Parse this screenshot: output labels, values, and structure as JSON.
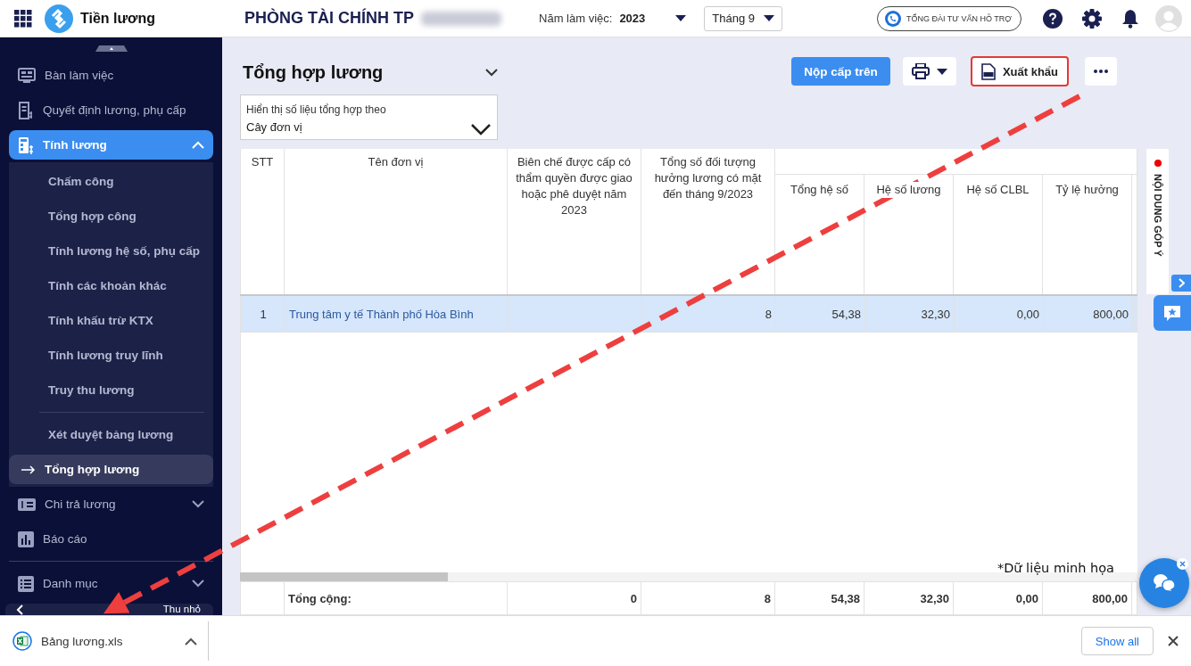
{
  "header": {
    "app_name": "Tiền lương",
    "org_title": "PHÒNG TÀI CHÍNH TP",
    "year_label": "Năm làm việc:",
    "year": "2023",
    "month": "Tháng 9",
    "hotline": "TỔNG ĐÀI TƯ VẤN HỖ TRỢ"
  },
  "sidebar": {
    "items": [
      {
        "label": "Bàn làm việc",
        "selected": false
      },
      {
        "label": "Quyết định lương, phụ cấp",
        "selected": false
      },
      {
        "label": "Tính lương",
        "selected": true,
        "expanded": true,
        "children": [
          {
            "label": "Chấm công",
            "selected": false
          },
          {
            "label": "Tổng hợp công",
            "selected": false
          },
          {
            "label": "Tính lương hệ số, phụ cấp",
            "selected": false
          },
          {
            "label": "Tính các khoản khác",
            "selected": false
          },
          {
            "label": "Tính khấu trừ KTX",
            "selected": false
          },
          {
            "label": "Tính lương truy lĩnh",
            "selected": false
          },
          {
            "label": "Truy thu lương",
            "selected": false
          },
          {
            "label": "Xét duyệt bảng lương",
            "selected": false,
            "group_break": true
          },
          {
            "label": "Tổng hợp lương",
            "selected": true
          }
        ]
      },
      {
        "label": "Chi trả lương",
        "selected": false,
        "expanded": false
      },
      {
        "label": "Báo cáo",
        "selected": false
      },
      {
        "label": "Danh mục",
        "selected": false,
        "expanded": false,
        "group_break": true
      }
    ],
    "collapse_label": "Thu nhỏ"
  },
  "page": {
    "title": "Tổng hợp lương",
    "filter": {
      "label": "Hiển thị số liệu tổng hợp theo",
      "value": "Cây đơn vị"
    },
    "actions": [
      {
        "kind": "primary",
        "label": "Nộp cấp trên"
      },
      {
        "kind": "print"
      },
      {
        "kind": "export",
        "label": "Xuất khẩu",
        "highlighted": true
      },
      {
        "kind": "more"
      }
    ]
  },
  "table": {
    "columns": [
      "STT",
      "Tên đơn vị",
      "Biên chế được cấp có thẩm quyền được giao hoặc phê duyệt năm 2023",
      "Tổng số đối tượng hưởng lương có mặt đến tháng 9/2023",
      "Tổng hệ số",
      "Hệ số lương",
      "Hệ số CLBL",
      "Tỷ lệ hưởng"
    ],
    "rows": [
      {
        "selected": true,
        "cells": [
          "1",
          "Trung tâm y tế Thành phố Hòa Bình",
          "",
          "8",
          "54,38",
          "32,30",
          "0,00",
          "800,00"
        ]
      }
    ],
    "totals": {
      "label": "Tổng cộng:",
      "values": [
        "0",
        "8",
        "54,38",
        "32,30",
        "0,00",
        "800,00"
      ]
    }
  },
  "feedback_tab": {
    "label": "NỘI DUNG GÓP Ý",
    "unread": true
  },
  "note": "*Dữ liệu minh họa",
  "download_bar": {
    "file": "Bảng lương.xls",
    "show_all": "Show all"
  }
}
